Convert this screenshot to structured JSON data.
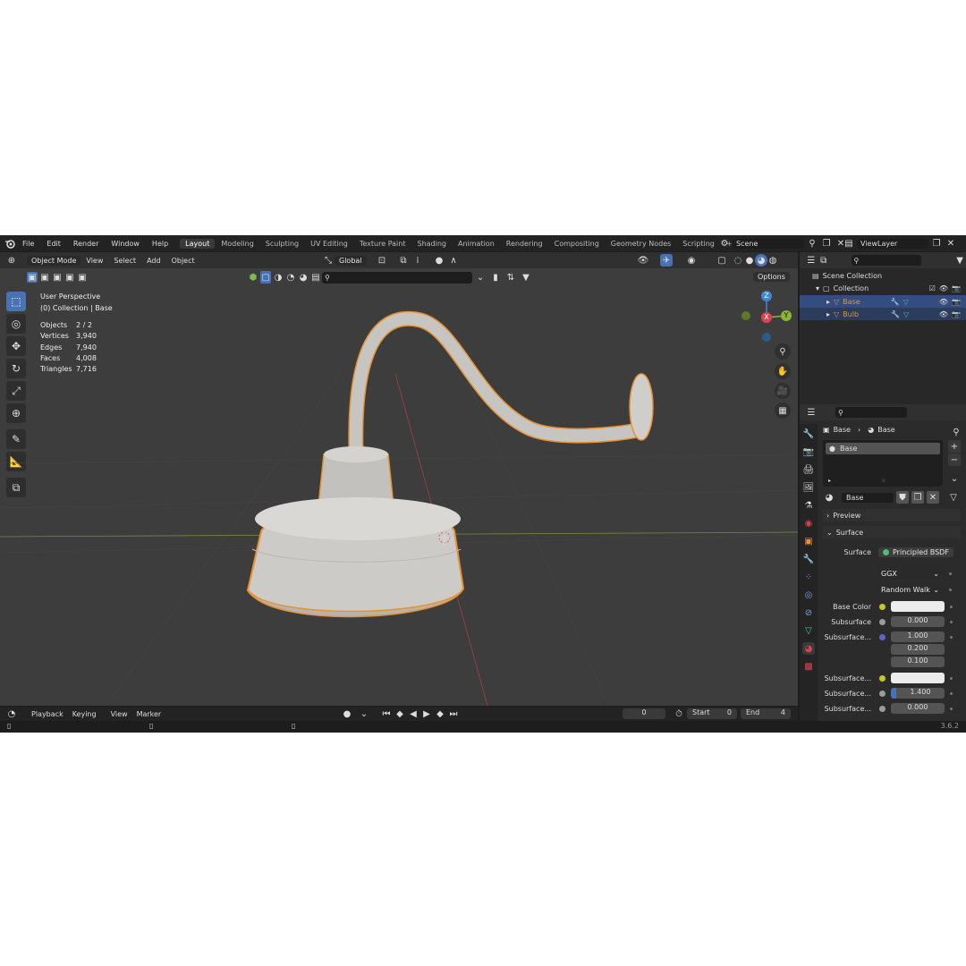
{
  "menu": {
    "items": [
      "File",
      "Edit",
      "Render",
      "Window",
      "Help"
    ],
    "workspaces": [
      "Layout",
      "Modeling",
      "Sculpting",
      "UV Editing",
      "Texture Paint",
      "Shading",
      "Animation",
      "Rendering",
      "Compositing",
      "Geometry Nodes",
      "Scripting"
    ],
    "active_workspace": "Layout",
    "add_tab": "+",
    "scene": "Scene",
    "view_layer": "ViewLayer"
  },
  "viewport": {
    "mode": "Object Mode",
    "menus": [
      "View",
      "Select",
      "Add",
      "Object"
    ],
    "transform_orientation": "Global",
    "options_label": "Options",
    "info_title": "User Perspective",
    "info_collection": "(0) Collection | Base",
    "stats": [
      {
        "label": "Objects",
        "value": "2 / 2"
      },
      {
        "label": "Vertices",
        "value": "3,940"
      },
      {
        "label": "Edges",
        "value": "7,940"
      },
      {
        "label": "Faces",
        "value": "4,008"
      },
      {
        "label": "Triangles",
        "value": "7,716"
      }
    ],
    "gizmo": {
      "z": "Z",
      "y": "Y",
      "x": "X"
    }
  },
  "outliner": {
    "root": "Scene Collection",
    "collection": "Collection",
    "objects": [
      {
        "name": "Base",
        "selected": true
      },
      {
        "name": "Bulb",
        "selected": false
      }
    ]
  },
  "properties": {
    "breadcrumb_object": "Base",
    "breadcrumb_material": "Base",
    "slot_name": "Base",
    "material_name": "Base",
    "panels": {
      "preview": "Preview",
      "surface": "Surface"
    },
    "surface_label": "Surface",
    "surface_value": "Principled BSDF",
    "distribution": "GGX",
    "subsurface_method": "Random Walk",
    "rows": [
      {
        "label": "Base Color",
        "value": ""
      },
      {
        "label": "Subsurface",
        "value": "0.000"
      },
      {
        "label": "Subsurface...",
        "value": "1.000"
      },
      {
        "label": "",
        "value": "0.200"
      },
      {
        "label": "",
        "value": "0.100"
      },
      {
        "label": "Subsurface...",
        "value": ""
      },
      {
        "label": "Subsurface...",
        "value": "1.400"
      },
      {
        "label": "Subsurface...",
        "value": "0.000"
      }
    ]
  },
  "timeline": {
    "menus": [
      "Playback",
      "Keying",
      "View",
      "Marker"
    ],
    "current_frame": "0",
    "start_label": "Start",
    "start_value": "0",
    "end_label": "End",
    "end_value": "4"
  },
  "statusbar": {
    "version": "3.6.2"
  },
  "colors": {
    "accent": "#4772b3",
    "selection": "#e8912f",
    "x_axis": "#d94452",
    "y_axis": "#8bb437",
    "z_axis": "#3e87d8"
  }
}
